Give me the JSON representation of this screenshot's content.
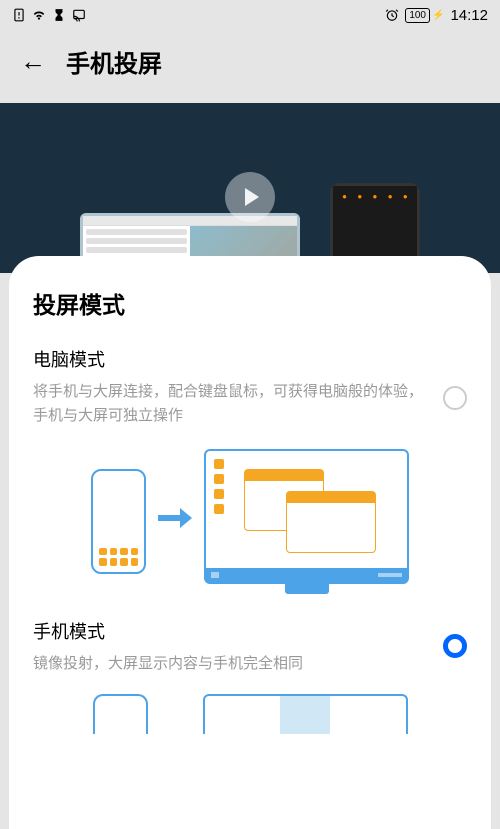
{
  "statusBar": {
    "batteryLevel": "100",
    "time": "14:12"
  },
  "header": {
    "pageTitle": "手机投屏"
  },
  "bottomSheet": {
    "title": "投屏模式",
    "modes": {
      "desktop": {
        "title": "电脑模式",
        "desc": "将手机与大屏连接，配合键盘鼠标，可获得电脑般的体验，手机与大屏可独立操作"
      },
      "phone": {
        "title": "手机模式",
        "desc": "镜像投射，大屏显示内容与手机完全相同"
      }
    }
  }
}
